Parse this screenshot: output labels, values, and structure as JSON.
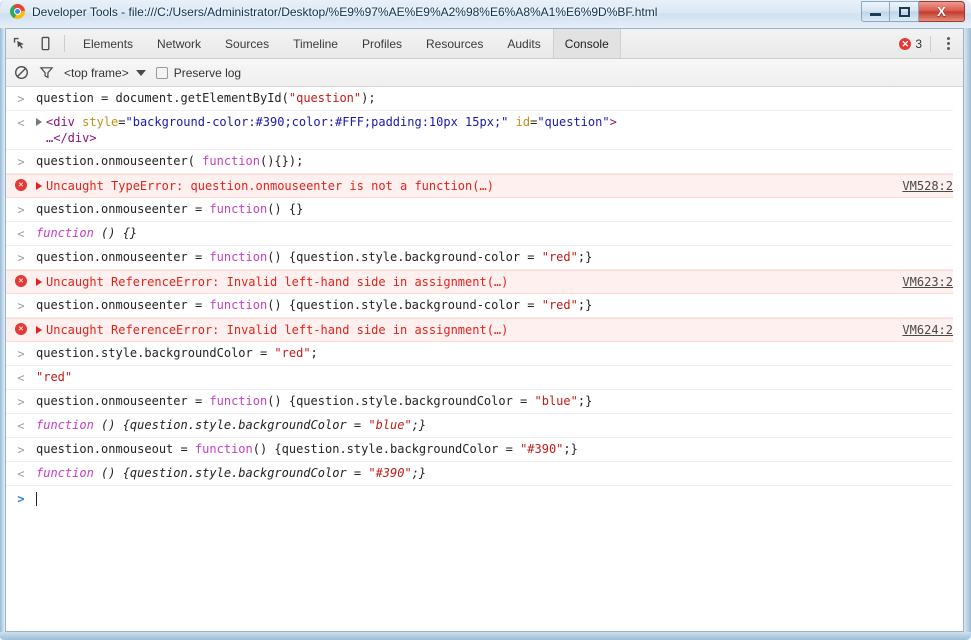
{
  "window": {
    "title": "Developer Tools - file:///C:/Users/Administrator/Desktop/%E9%97%AE%E9%A2%98%E6%A8%A1%E6%9D%BF.html",
    "logo_icon": "chrome-logo-icon",
    "controls": {
      "minimize": "minimize-icon",
      "maximize": "maximize-icon",
      "close": "X"
    },
    "accent_color": "#b9d3e8"
  },
  "toolbar": {
    "inspect_icon": "inspect-element-icon",
    "device_icon": "device-toolbar-icon",
    "tabs": [
      {
        "label": "Elements",
        "active": false
      },
      {
        "label": "Network",
        "active": false
      },
      {
        "label": "Sources",
        "active": false
      },
      {
        "label": "Timeline",
        "active": false
      },
      {
        "label": "Profiles",
        "active": false
      },
      {
        "label": "Resources",
        "active": false
      },
      {
        "label": "Audits",
        "active": false
      },
      {
        "label": "Console",
        "active": true
      }
    ],
    "error_count": "3",
    "error_icon": "error-circle-icon",
    "menu_icon": "kebab-menu-icon",
    "error_color": "#e53935"
  },
  "filterbar": {
    "clear_icon": "clear-console-icon",
    "filter_icon": "filter-funnel-icon",
    "context": "<top frame>",
    "context_caret": "chevron-down-icon",
    "preserve_log_label": "Preserve log",
    "preserve_log_checked": false
  },
  "console": {
    "messages": [
      {
        "type": "input",
        "gutter": ">",
        "text": "question = document.getElementById(\"question\");",
        "segments": [
          {
            "t": "question = document.getElementById(",
            "c": "plain"
          },
          {
            "t": "\"question\"",
            "c": "str"
          },
          {
            "t": ");",
            "c": "plain"
          }
        ]
      },
      {
        "type": "output",
        "gutter": "<",
        "expandable": true,
        "text": "<div style=\"background-color:#390;color:#FFF;padding:10px 15px;\" id=\"question\">…</div>",
        "segments": [
          {
            "t": "<div",
            "c": "tag"
          },
          {
            "t": " style",
            "c": "attr"
          },
          {
            "t": "=",
            "c": "plain"
          },
          {
            "t": "\"background-color:#390;color:#FFF;padding:10px 15px;\"",
            "c": "val"
          },
          {
            "t": " id",
            "c": "attr"
          },
          {
            "t": "=",
            "c": "plain"
          },
          {
            "t": "\"question\"",
            "c": "val"
          },
          {
            "t": ">\n…",
            "c": "tag"
          },
          {
            "t": "</div>",
            "c": "tag"
          }
        ]
      },
      {
        "type": "input",
        "gutter": ">",
        "text": "question.onmouseenter( function(){});",
        "segments": [
          {
            "t": "question.onmouseenter( ",
            "c": "plain"
          },
          {
            "t": "function",
            "c": "kw"
          },
          {
            "t": "(){});",
            "c": "plain"
          }
        ]
      },
      {
        "type": "error",
        "gutter": "error-icon",
        "expandable": true,
        "text": "Uncaught TypeError: question.onmouseenter is not a function(…)",
        "link": "VM528:2"
      },
      {
        "type": "input",
        "gutter": ">",
        "text": "question.onmouseenter = function() {}",
        "segments": [
          {
            "t": "question.onmouseenter = ",
            "c": "plain"
          },
          {
            "t": "function",
            "c": "kw"
          },
          {
            "t": "() {}",
            "c": "plain"
          }
        ]
      },
      {
        "type": "output",
        "gutter": "<",
        "italic": true,
        "text": "function () {}",
        "segments": [
          {
            "t": "function",
            "c": "kw"
          },
          {
            "t": " () {}",
            "c": "plain"
          }
        ]
      },
      {
        "type": "input",
        "gutter": ">",
        "text": "question.onmouseenter = function() {question.style.background-color = \"red\";}",
        "segments": [
          {
            "t": "question.onmouseenter = ",
            "c": "plain"
          },
          {
            "t": "function",
            "c": "kw"
          },
          {
            "t": "() {question.style.background-color = ",
            "c": "plain"
          },
          {
            "t": "\"red\"",
            "c": "str"
          },
          {
            "t": ";}",
            "c": "plain"
          }
        ]
      },
      {
        "type": "error",
        "gutter": "error-icon",
        "expandable": true,
        "text": "Uncaught ReferenceError: Invalid left-hand side in assignment(…)",
        "link": "VM623:2"
      },
      {
        "type": "input",
        "gutter": ">",
        "text": "question.onmouseenter = function() {question.style.background-color = \"red\";}",
        "segments": [
          {
            "t": "question.onmouseenter = ",
            "c": "plain"
          },
          {
            "t": "function",
            "c": "kw"
          },
          {
            "t": "() {question.style.background-color = ",
            "c": "plain"
          },
          {
            "t": "\"red\"",
            "c": "str"
          },
          {
            "t": ";}",
            "c": "plain"
          }
        ]
      },
      {
        "type": "error",
        "gutter": "error-icon",
        "expandable": true,
        "text": "Uncaught ReferenceError: Invalid left-hand side in assignment(…)",
        "link": "VM624:2"
      },
      {
        "type": "input",
        "gutter": ">",
        "text": "question.style.backgroundColor = \"red\";",
        "segments": [
          {
            "t": "question.style.backgroundColor = ",
            "c": "plain"
          },
          {
            "t": "\"red\"",
            "c": "str"
          },
          {
            "t": ";",
            "c": "plain"
          }
        ]
      },
      {
        "type": "output",
        "gutter": "<",
        "text": "\"red\"",
        "segments": [
          {
            "t": "\"red\"",
            "c": "str"
          }
        ]
      },
      {
        "type": "input",
        "gutter": ">",
        "text": "question.onmouseenter = function() {question.style.backgroundColor = \"blue\";}",
        "segments": [
          {
            "t": "question.onmouseenter = ",
            "c": "plain"
          },
          {
            "t": "function",
            "c": "kw"
          },
          {
            "t": "() {question.style.backgroundColor = ",
            "c": "plain"
          },
          {
            "t": "\"blue\"",
            "c": "str"
          },
          {
            "t": ";}",
            "c": "plain"
          }
        ]
      },
      {
        "type": "output",
        "gutter": "<",
        "italic": true,
        "text": "function () {question.style.backgroundColor = \"blue\";}",
        "segments": [
          {
            "t": "function",
            "c": "kw"
          },
          {
            "t": " () {question.style.backgroundColor = ",
            "c": "plain"
          },
          {
            "t": "\"blue\"",
            "c": "str"
          },
          {
            "t": ";}",
            "c": "plain"
          }
        ]
      },
      {
        "type": "input",
        "gutter": ">",
        "text": "question.onmouseout = function() {question.style.backgroundColor = \"#390\";}",
        "segments": [
          {
            "t": "question.onmouseout = ",
            "c": "plain"
          },
          {
            "t": "function",
            "c": "kw"
          },
          {
            "t": "() {question.style.backgroundColor = ",
            "c": "plain"
          },
          {
            "t": "\"#390\"",
            "c": "str"
          },
          {
            "t": ";}",
            "c": "plain"
          }
        ]
      },
      {
        "type": "output",
        "gutter": "<",
        "italic": true,
        "text": "function () {question.style.backgroundColor = \"#390\";}",
        "segments": [
          {
            "t": "function",
            "c": "kw"
          },
          {
            "t": " () {question.style.backgroundColor = ",
            "c": "plain"
          },
          {
            "t": "\"#390\"",
            "c": "str"
          },
          {
            "t": ";}",
            "c": "plain"
          }
        ]
      }
    ],
    "prompt": {
      "arrow": ">",
      "value": ""
    }
  }
}
